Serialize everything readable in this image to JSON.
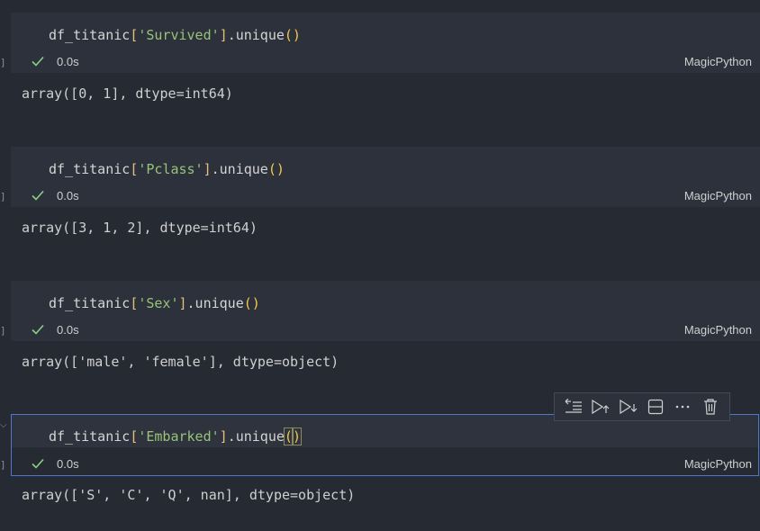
{
  "language_label": "MagicPython",
  "exec_marker": "]",
  "cells": [
    {
      "code": {
        "prefix": "df_titanic",
        "open": "[",
        "string": "'Survived'",
        "close": "]",
        "method": ".unique",
        "parens": "()"
      },
      "status": "0.0s",
      "output": "array([0, 1], dtype=int64)"
    },
    {
      "code": {
        "prefix": "df_titanic",
        "open": "[",
        "string": "'Pclass'",
        "close": "]",
        "method": ".unique",
        "parens": "()"
      },
      "status": "0.0s",
      "output": "array([3, 1, 2], dtype=int64)"
    },
    {
      "code": {
        "prefix": "df_titanic",
        "open": "[",
        "string": "'Sex'",
        "close": "]",
        "method": ".unique",
        "parens": "()"
      },
      "status": "0.0s",
      "output": "array(['male', 'female'], dtype=object)"
    },
    {
      "code": {
        "prefix": "df_titanic",
        "open": "[",
        "string": "'Embarked'",
        "close": "]",
        "method": ".unique",
        "parens_open": "(",
        "parens_close": ")"
      },
      "status": "0.0s",
      "output": "array(['S', 'C', 'Q', nan], dtype=object)"
    }
  ],
  "toolbar": {
    "icons": [
      "execute-above-icon",
      "run-above-icon",
      "run-below-icon",
      "split-cell-icon",
      "more-icon",
      "delete-icon"
    ]
  },
  "colors": {
    "background": "#262a33",
    "cell_background": "#2d313b",
    "string": "#98c379",
    "bracket": "#e5c07b",
    "check": "#89d185",
    "selected_border": "#4d78cc"
  }
}
